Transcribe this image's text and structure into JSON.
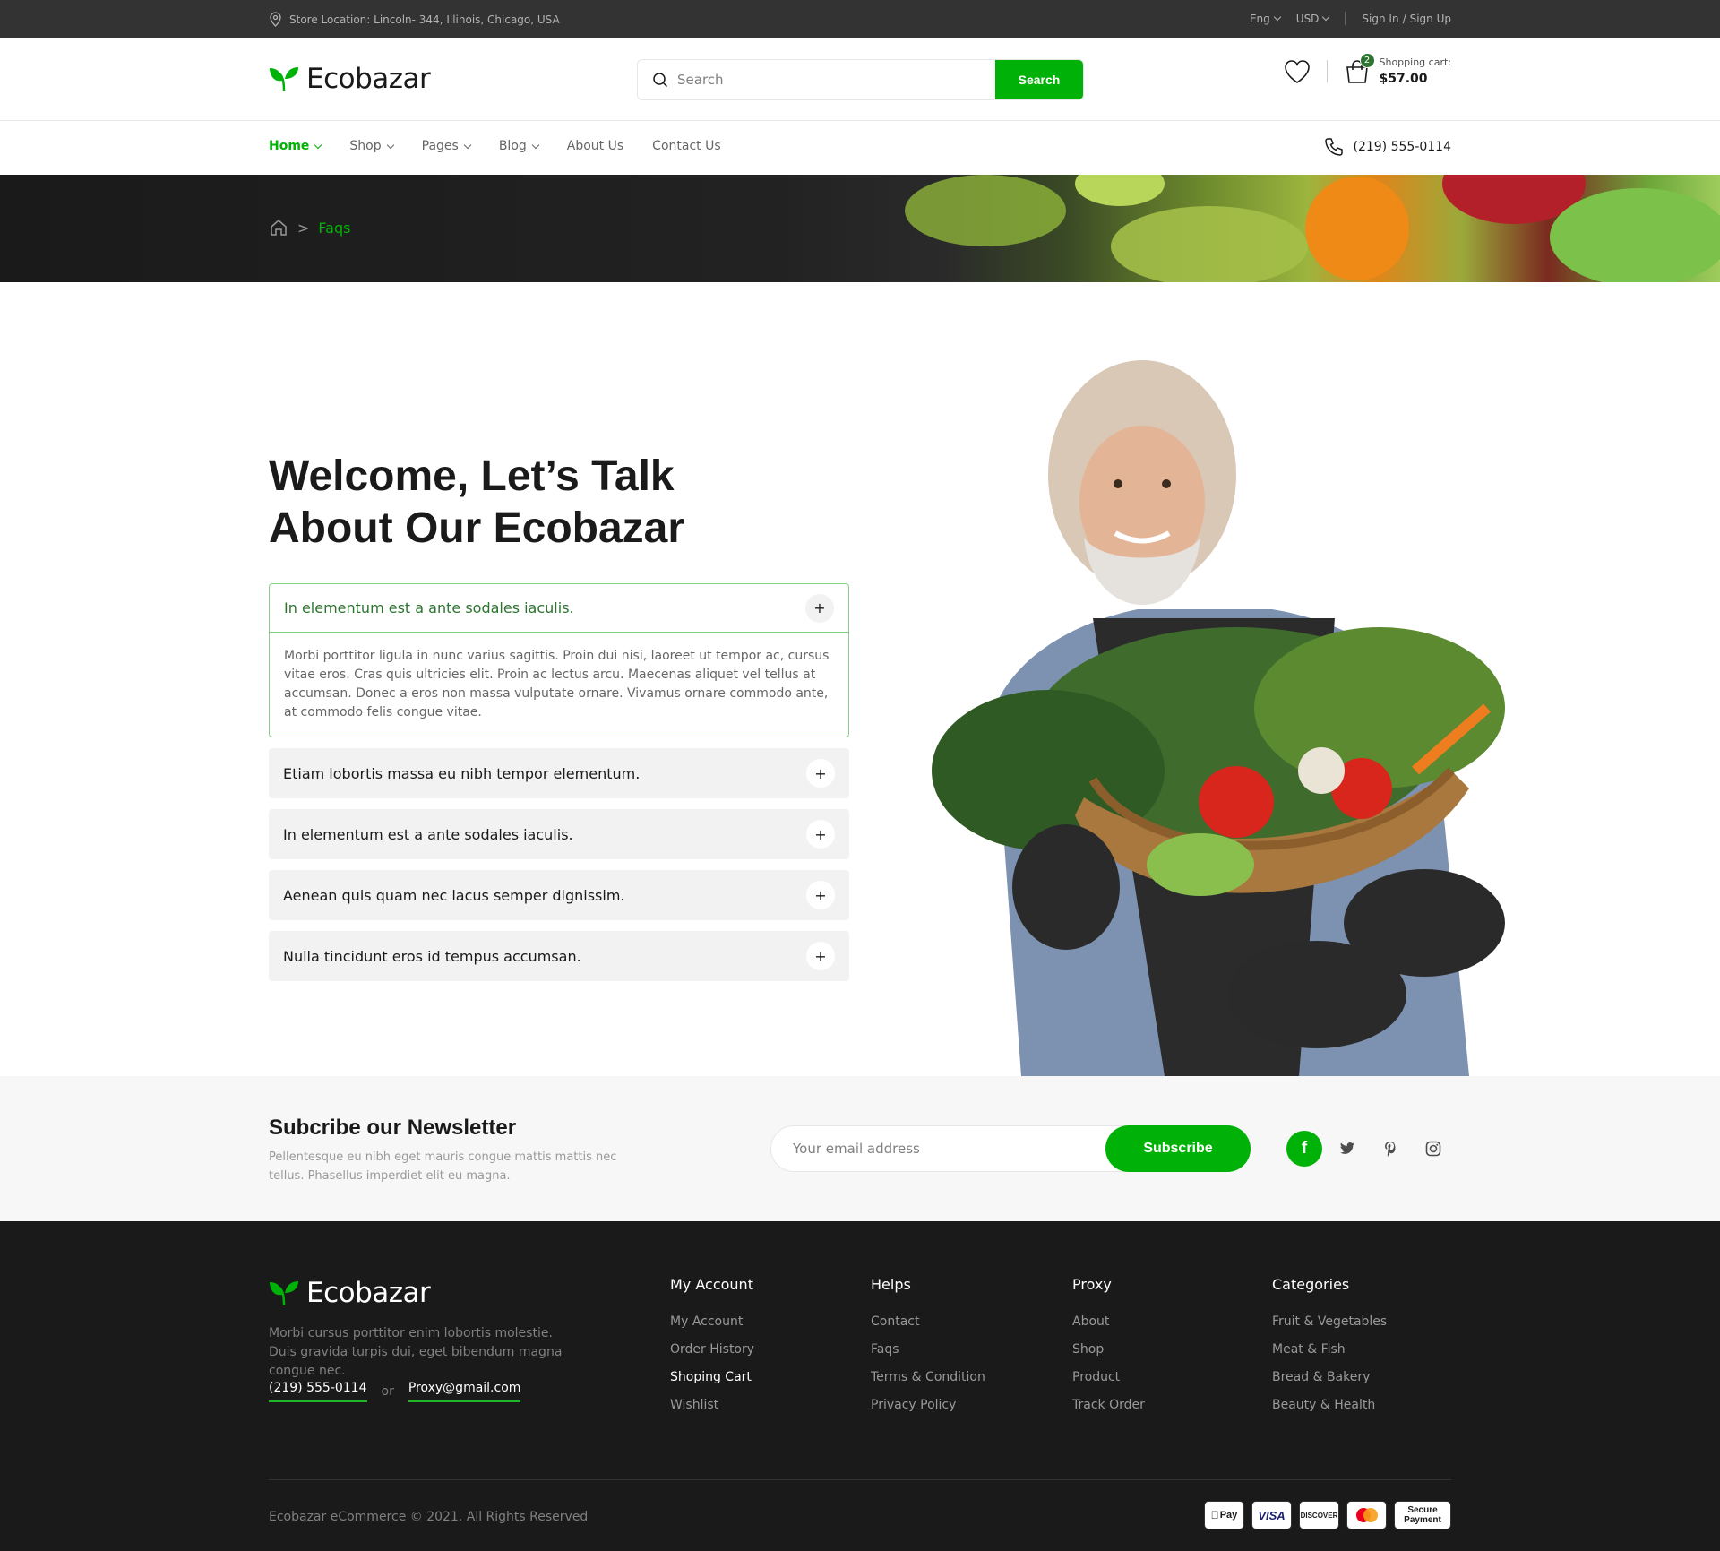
{
  "topbar": {
    "location": "Store Location: Lincoln- 344, Illinois, Chicago, USA",
    "language": "Eng",
    "currency": "USD",
    "sign_in": "Sign In",
    "slash": "/",
    "sign_up": "Sign Up"
  },
  "header": {
    "logo": "Ecobazar",
    "search_placeholder": "Search",
    "search_button": "Search",
    "cart_count": "2",
    "cart_label": "Shopping cart:",
    "cart_amount": "$57.00"
  },
  "nav": {
    "items": [
      {
        "label": "Home"
      },
      {
        "label": "Shop"
      },
      {
        "label": "Pages"
      },
      {
        "label": "Blog"
      },
      {
        "label": "About Us"
      },
      {
        "label": "Contact Us"
      }
    ],
    "phone": "(219) 555-0114"
  },
  "breadcrumb": {
    "separator": ">",
    "current": "Faqs"
  },
  "main": {
    "title_line1": "Welcome, Let’s Talk",
    "title_line2": "About Our Ecobazar",
    "faq": [
      {
        "question": "In elementum est a ante sodales iaculis.",
        "answer": "Morbi porttitor ligula in nunc varius sagittis. Proin dui nisi, laoreet ut tempor ac, cursus vitae eros. Cras quis ultricies elit. Proin ac lectus arcu. Maecenas aliquet vel tellus at accumsan. Donec a eros non massa vulputate ornare. Vivamus ornare commodo ante, at commodo felis congue vitae."
      },
      {
        "question": "Etiam lobortis massa eu nibh tempor elementum."
      },
      {
        "question": "In elementum est a ante sodales iaculis."
      },
      {
        "question": "Aenean quis quam nec lacus semper dignissim."
      },
      {
        "question": "Nulla tincidunt eros id tempus accumsan."
      }
    ],
    "toggle_symbol": "+"
  },
  "newsletter": {
    "title": "Subcribe our Newsletter",
    "text": "Pellentesque eu nibh eget mauris congue mattis mattis nec tellus. Phasellus imperdiet elit eu magna.",
    "placeholder": "Your email address",
    "button": "Subscribe",
    "social": [
      "facebook-icon",
      "twitter-icon",
      "pinterest-icon",
      "instagram-icon"
    ]
  },
  "footer": {
    "logo": "Ecobazar",
    "description": "Morbi cursus porttitor enim lobortis molestie. Duis gravida turpis dui, eget bibendum magna congue nec.",
    "phone": "(219) 555-0114",
    "or": "or",
    "email": "Proxy@gmail.com",
    "columns": [
      {
        "title": "My Account",
        "links": [
          "My Account",
          "Order History",
          "Shoping Cart",
          "Wishlist"
        ]
      },
      {
        "title": "Helps",
        "links": [
          "Contact",
          "Faqs",
          "Terms & Condition",
          "Privacy Policy"
        ]
      },
      {
        "title": "Proxy",
        "links": [
          "About",
          "Shop",
          "Product",
          "Track Order"
        ]
      },
      {
        "title": "Categories",
        "links": [
          "Fruit & Vegetables",
          "Meat & Fish",
          "Bread & Bakery",
          "Beauty & Health"
        ]
      }
    ],
    "copyright": "Ecobazar eCommerce © 2021. All Rights Reserved",
    "payments": {
      "apple": "Pay",
      "visa": "VISA",
      "discover": "DISCOVER",
      "secure_top": "Secure",
      "secure_bottom": "Payment"
    }
  },
  "colors": {
    "primary": "#00b207",
    "dark_green": "#2c742f",
    "topbar_bg": "#333333",
    "footer_bg": "#1a1a1a"
  }
}
